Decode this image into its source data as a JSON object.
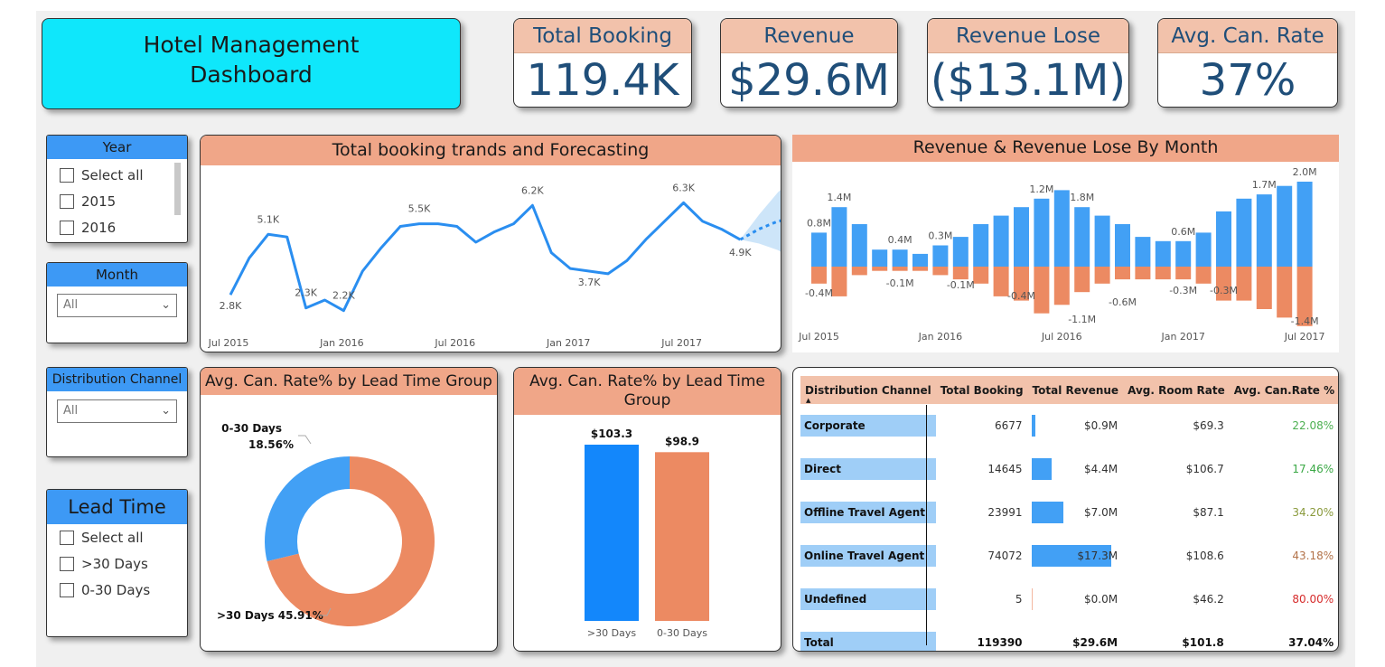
{
  "title": {
    "line1": "Hotel Management",
    "line2": "Dashboard"
  },
  "kpis": [
    {
      "label": "Total Booking",
      "value": "119.4K"
    },
    {
      "label": "Revenue",
      "value": "$29.6M"
    },
    {
      "label": "Revenue Lose",
      "value": "($13.1M)"
    },
    {
      "label": "Avg. Can. Rate",
      "value": "37%"
    }
  ],
  "slicers": {
    "year": {
      "title": "Year",
      "items": [
        "Select all",
        "2015",
        "2016"
      ]
    },
    "month": {
      "title": "Month",
      "value": "All"
    },
    "channel": {
      "title": "Distribution Channel",
      "value": "All"
    },
    "lead": {
      "title": "Lead Time",
      "items": [
        "Select all",
        ">30 Days",
        "0-30 Days"
      ]
    }
  },
  "icons": {
    "checkbox": "checkbox-empty-icon",
    "dropdown": "chevron-down-icon",
    "sort": "sort-asc-icon"
  },
  "colors": {
    "accent_blue": "#2a8ef0",
    "orange": "#ec8a62",
    "header_peach": "#f2c2ab",
    "title_cyan": "#0fe7fb",
    "dark_blue_text": "#1f4e79"
  },
  "chart_data": [
    {
      "type": "line",
      "title": "Total booking trands and Forecasting",
      "x_ticks": [
        "Jul 2015",
        "Jan 2016",
        "Jul 2016",
        "Jan 2017",
        "Jul 2017"
      ],
      "series": [
        {
          "values": [
            2.8,
            4.2,
            5.1,
            5.0,
            2.3,
            2.6,
            2.2,
            3.7,
            4.6,
            5.4,
            5.5,
            5.5,
            5.4,
            4.8,
            5.2,
            5.5,
            6.2,
            4.4,
            3.8,
            3.7,
            3.6,
            4.1,
            4.9,
            5.6,
            6.3,
            5.6,
            5.3,
            4.9
          ]
        },
        {
          "values": [
            4.9,
            5.3,
            5.6,
            5.7,
            5.0
          ]
        }
      ],
      "data_labels": [
        "2.8K",
        "5.1K",
        "2.3K",
        "2.2K",
        "5.5K",
        "6.2K",
        "3.7K",
        "6.3K",
        "4.9K"
      ],
      "y_unit": "K"
    },
    {
      "type": "bar",
      "title": "Revenue & Revenue Lose By Month",
      "x_ticks": [
        "Jul 2015",
        "Jan 2016",
        "Jul 2016",
        "Jan 2017",
        "Jul 2017"
      ],
      "series": [
        {
          "values": [
            0.8,
            1.4,
            1.0,
            0.4,
            0.4,
            0.3,
            0.5,
            0.7,
            1.0,
            1.2,
            1.4,
            1.6,
            1.8,
            1.4,
            1.2,
            1.0,
            0.7,
            0.6,
            0.6,
            0.8,
            1.3,
            1.6,
            1.7,
            1.9,
            2.0
          ]
        },
        {
          "values": [
            -0.4,
            -0.7,
            -0.2,
            -0.1,
            -0.1,
            -0.1,
            -0.2,
            -0.3,
            -0.4,
            -0.7,
            -0.8,
            -1.1,
            -0.9,
            -0.6,
            -0.4,
            -0.3,
            -0.3,
            -0.3,
            -0.3,
            -0.4,
            -0.8,
            -0.8,
            -1.0,
            -1.2,
            -1.4
          ]
        }
      ],
      "data_labels_top": [
        "0.8M",
        "1.4M",
        "0.4M",
        "0.3M",
        "1.2M",
        "1.8M",
        "0.6M",
        "1.7M",
        "2.0M"
      ],
      "data_labels_bottom": [
        "-0.4M",
        "-0.1M",
        "-0.1M",
        "-0.4M",
        "-1.1M",
        "-0.6M",
        "-0.3M",
        "-0.3M",
        "-1.4M"
      ]
    },
    {
      "type": "pie",
      "title": "Avg. Can. Rate% by Lead Time Group",
      "slices": [
        {
          "label": "0-30 Days",
          "value": 18.56,
          "display": "18.56%"
        },
        {
          "label": ">30 Days",
          "value": 45.91,
          "display": ">30 Days 45.91%"
        }
      ]
    },
    {
      "type": "bar",
      "title": "Avg. Can. Rate% by Lead Time Group",
      "categories": [
        ">30 Days",
        "0-30 Days"
      ],
      "values": [
        103.3,
        98.9
      ],
      "labels": [
        "$103.3",
        "$98.9"
      ],
      "ylim": [
        0,
        110
      ]
    },
    {
      "type": "table",
      "columns": [
        "Distribution Channel",
        "Total Booking",
        "Total Revenue",
        "Avg. Room Rate",
        "Avg. Can.Rate %"
      ],
      "rows": [
        {
          "channel": "Corporate",
          "booking": "6677",
          "revenue": "$0.9M",
          "rev_value": 0.9,
          "room_rate": "$69.3",
          "can_rate": "22.08%",
          "can_color": "#4caf50"
        },
        {
          "channel": "Direct",
          "booking": "14645",
          "revenue": "$4.4M",
          "rev_value": 4.4,
          "room_rate": "$106.7",
          "can_rate": "17.46%",
          "can_color": "#3aa845"
        },
        {
          "channel": "Offline Travel Agent",
          "booking": "23991",
          "revenue": "$7.0M",
          "rev_value": 7.0,
          "room_rate": "$87.1",
          "can_rate": "34.20%",
          "can_color": "#8a9a3c"
        },
        {
          "channel": "Online Travel Agent",
          "booking": "74072",
          "revenue": "$17.3M",
          "rev_value": 17.3,
          "room_rate": "$108.6",
          "can_rate": "43.18%",
          "can_color": "#b3734a"
        },
        {
          "channel": "Undefined",
          "booking": "5",
          "revenue": "$0.0M",
          "rev_value": 0.0,
          "room_rate": "$46.2",
          "can_rate": "80.00%",
          "can_color": "#d62b2b"
        }
      ],
      "total": {
        "channel": "Total",
        "booking": "119390",
        "revenue": "$29.6M",
        "room_rate": "$101.8",
        "can_rate": "37.04%"
      }
    }
  ]
}
